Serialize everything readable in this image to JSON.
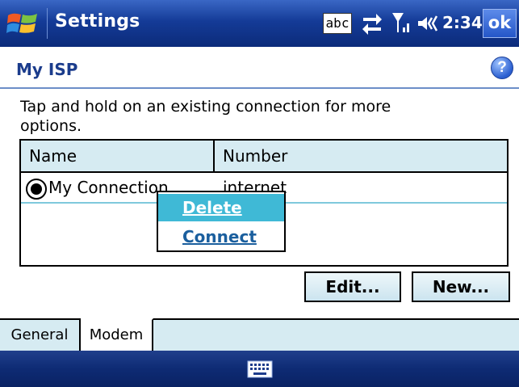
{
  "titlebar": {
    "title": "Settings",
    "input_indicator": "abc",
    "time": "2:34",
    "ok_label": "ok",
    "icons": [
      "windows-start-icon",
      "sync-icon",
      "signal-icon",
      "volume-icon"
    ]
  },
  "page": {
    "title": "My ISP",
    "help_label": "?"
  },
  "instructions": "Tap and hold on an existing connection for more options.",
  "listview": {
    "columns": [
      "Name",
      "Number"
    ],
    "rows": [
      {
        "name": "My Connection",
        "number": "internet",
        "selected": true
      }
    ]
  },
  "context_menu": {
    "items": [
      "Delete",
      "Connect"
    ],
    "highlighted": "Delete"
  },
  "buttons": {
    "edit": "Edit...",
    "new": "New..."
  },
  "tabs": [
    {
      "label": "General",
      "active": false
    },
    {
      "label": "Modem",
      "active": true
    }
  ],
  "colors": {
    "titlebar": "#143b97",
    "accent": "#3fb9d6",
    "header_bg": "#d6ebf2"
  }
}
